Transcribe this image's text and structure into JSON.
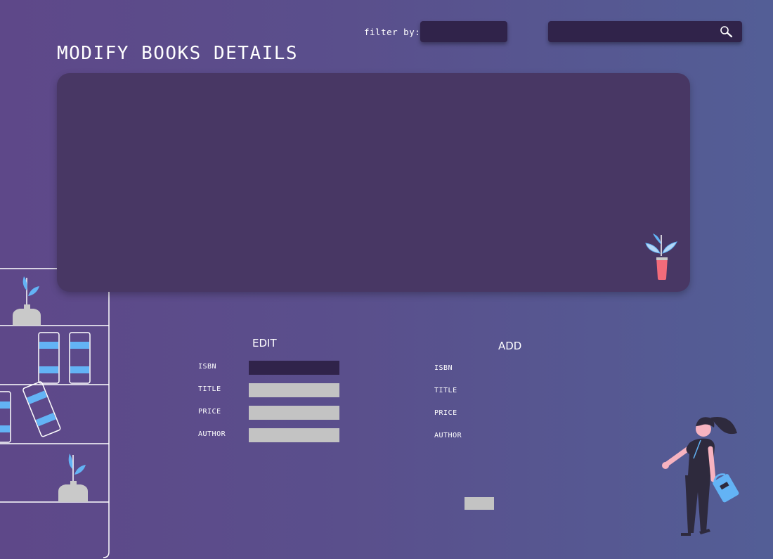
{
  "filter": {
    "label": "filter by:",
    "value": ""
  },
  "search": {
    "value": "",
    "icon": "search-icon"
  },
  "page_title": "MODIFY BOOKS DETAILS",
  "edit_form": {
    "heading": "EDIT",
    "fields": {
      "isbn": {
        "label": "ISBN",
        "value": ""
      },
      "title": {
        "label": "TITLE",
        "value": ""
      },
      "price": {
        "label": "PRICE",
        "value": ""
      },
      "author": {
        "label": "AUTHOR",
        "value": ""
      }
    }
  },
  "add_form": {
    "heading": "ADD",
    "fields": {
      "isbn": {
        "label": "ISBN"
      },
      "title": {
        "label": "TITLE"
      },
      "price": {
        "label": "PRICE"
      },
      "author": {
        "label": "AUTHOR"
      }
    },
    "submit_label": ""
  },
  "colors": {
    "background_start": "#5e4889",
    "background_end": "#535e96",
    "panel": "#483764",
    "input_dark": "#30234a",
    "input_light": "#c3c3c3",
    "accent_blue": "#63b3f5",
    "accent_pink": "#f26b7a"
  }
}
